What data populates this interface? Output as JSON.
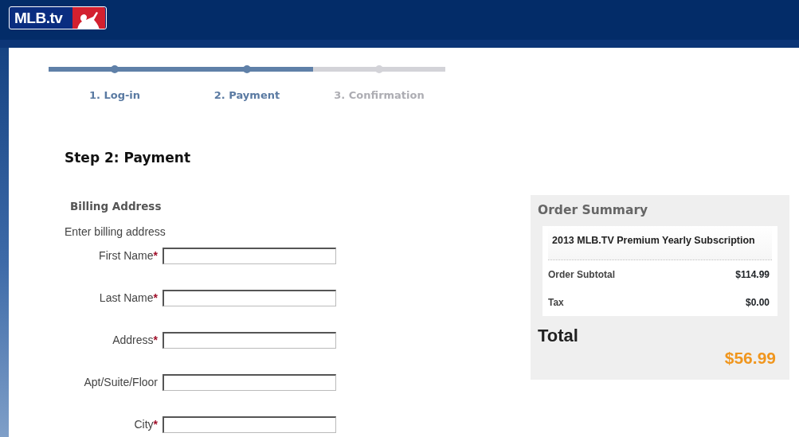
{
  "header": {
    "logo_text": "MLB.tv"
  },
  "steps": [
    {
      "label": "1. Log-in",
      "completed": true
    },
    {
      "label": "2. Payment",
      "completed": true
    },
    {
      "label": "3. Confirmation",
      "completed": false
    }
  ],
  "page_title": "Step 2: Payment",
  "billing": {
    "heading": "Billing Address",
    "instruction": "Enter billing address",
    "fields": [
      {
        "label": "First Name",
        "required": true
      },
      {
        "label": "Last Name",
        "required": true
      },
      {
        "label": "Address",
        "required": true
      },
      {
        "label": "Apt/Suite/Floor",
        "required": false
      },
      {
        "label": "City",
        "required": true
      }
    ],
    "required_mark": "*"
  },
  "order_summary": {
    "heading": "Order Summary",
    "item": "2013 MLB.TV Premium Yearly Subscription",
    "lines": [
      {
        "label": "Order Subtotal",
        "value": "$114.99"
      },
      {
        "label": "Tax",
        "value": "$0.00"
      }
    ],
    "total_label": "Total",
    "total_value": "$56.99"
  }
}
